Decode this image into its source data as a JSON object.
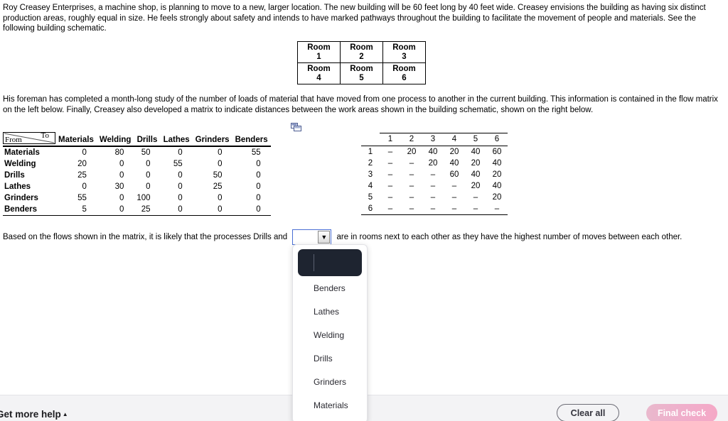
{
  "intro": {
    "paragraph1": "Roy Creasey Enterprises, a machine shop, is planning to move to a new, larger location. The new building will be 60 feet long by 40 feet wide. Creasey envisions the building as having six distinct production areas, roughly equal in size. He feels strongly about safety and intends to have marked pathways throughout the building to facilitate the movement of people and materials. See the following building schematic.",
    "paragraph2": "His foreman has completed a month-long study of the number of loads of material that have moved from one process to another in the current building. This information is contained in the flow matrix on the left below. Finally, Creasey also developed a matrix to indicate distances between the work areas shown in the building schematic, shown on the right below."
  },
  "schematic": {
    "rows": [
      [
        {
          "label": "Room",
          "number": "1"
        },
        {
          "label": "Room",
          "number": "2"
        },
        {
          "label": "Room",
          "number": "3"
        }
      ],
      [
        {
          "label": "Room",
          "number": "4"
        },
        {
          "label": "Room",
          "number": "5"
        },
        {
          "label": "Room",
          "number": "6"
        }
      ]
    ]
  },
  "flow_matrix": {
    "corner_from": "From",
    "corner_to": "To",
    "columns": [
      "Materials",
      "Welding",
      "Drills",
      "Lathes",
      "Grinders",
      "Benders"
    ],
    "rows": [
      {
        "label": "Materials",
        "values": [
          "0",
          "80",
          "50",
          "0",
          "0",
          "55"
        ]
      },
      {
        "label": "Welding",
        "values": [
          "20",
          "0",
          "0",
          "55",
          "0",
          "0"
        ]
      },
      {
        "label": "Drills",
        "values": [
          "25",
          "0",
          "0",
          "0",
          "50",
          "0"
        ]
      },
      {
        "label": "Lathes",
        "values": [
          "0",
          "30",
          "0",
          "0",
          "25",
          "0"
        ]
      },
      {
        "label": "Grinders",
        "values": [
          "55",
          "0",
          "100",
          "0",
          "0",
          "0"
        ]
      },
      {
        "label": "Benders",
        "values": [
          "5",
          "0",
          "25",
          "0",
          "0",
          "0"
        ]
      }
    ]
  },
  "distance_matrix": {
    "columns": [
      "1",
      "2",
      "3",
      "4",
      "5",
      "6"
    ],
    "rows": [
      {
        "label": "1",
        "values": [
          "–",
          "20",
          "40",
          "20",
          "40",
          "60"
        ]
      },
      {
        "label": "2",
        "values": [
          "–",
          "–",
          "20",
          "40",
          "20",
          "40"
        ]
      },
      {
        "label": "3",
        "values": [
          "–",
          "–",
          "–",
          "60",
          "40",
          "20"
        ]
      },
      {
        "label": "4",
        "values": [
          "–",
          "–",
          "–",
          "–",
          "20",
          "40"
        ]
      },
      {
        "label": "5",
        "values": [
          "–",
          "–",
          "–",
          "–",
          "–",
          "20"
        ]
      },
      {
        "label": "6",
        "values": [
          "–",
          "–",
          "–",
          "–",
          "–",
          "–"
        ]
      }
    ]
  },
  "question": {
    "text_before": "Based on the flows shown in the matrix, it is likely that the processes Drills and",
    "text_after": "are in rooms next to each other as they have the highest number of moves between each other.",
    "select_value": "",
    "select_arrow": "▼"
  },
  "dropdown": {
    "options": [
      {
        "label": "",
        "selected": true
      },
      {
        "label": "Benders",
        "selected": false
      },
      {
        "label": "Lathes",
        "selected": false
      },
      {
        "label": "Welding",
        "selected": false
      },
      {
        "label": "Drills",
        "selected": false
      },
      {
        "label": "Grinders",
        "selected": false
      },
      {
        "label": "Materials",
        "selected": false
      }
    ]
  },
  "footer": {
    "get_more_help": "Get more help",
    "get_more_help_caret": "▲",
    "clear_all": "Clear all",
    "final_check": "Final check"
  },
  "colors": {
    "select_border": "#4a6fd4",
    "dropdown_selected_bg": "#1e2430",
    "final_check_pink": "#f0aecb",
    "footer_bg": "#f3f3f5"
  }
}
